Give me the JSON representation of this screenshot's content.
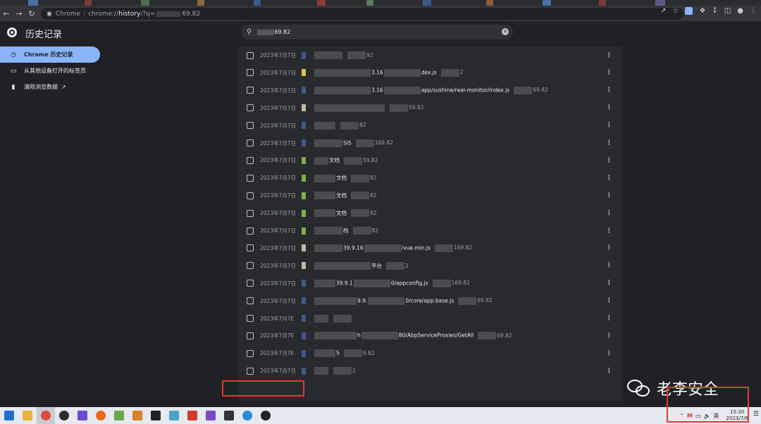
{
  "window": {
    "address": {
      "scheme_label": "Chrome",
      "url_prefix": "chrome://",
      "url_path": "history",
      "url_suffix": "/?q=",
      "url_tail": "69.82"
    }
  },
  "page": {
    "title": "历史记录",
    "search_value_tail": "69.82"
  },
  "sidebar": {
    "items": [
      {
        "label": "Chrome 历史记录",
        "icon": "clock-icon",
        "active": true
      },
      {
        "label": "从其他设备打开的标签页",
        "icon": "devices-icon",
        "active": false
      },
      {
        "label": "清除浏览数据",
        "icon": "trash-icon",
        "active": false
      }
    ]
  },
  "history": {
    "entries": [
      {
        "date": "2023年7月7日",
        "title": "",
        "domain": "92",
        "favicon_color": "#3c5a8a"
      },
      {
        "date": "2023年7月7日",
        "title": "3.16",
        "title2": "dex.js",
        "domain": "2",
        "favicon_color": "#d9c34a"
      },
      {
        "date": "2023年7月7日",
        "title": "3.16",
        "title2": "app/sushine/real-monitor/index.js",
        "domain": "69.82",
        "favicon_color": "#3c5a8a"
      },
      {
        "date": "2023年7月7日",
        "title": "",
        "domain": "59.82",
        "favicon_color": "#c2b8a0"
      },
      {
        "date": "2023年7月7日",
        "title": "",
        "domain": "82",
        "favicon_color": "#3c5a8a"
      },
      {
        "date": "2023年7月7日",
        "title": "SIS",
        "domain": "169.82",
        "favicon_color": "#3c5a8a"
      },
      {
        "date": "2023年7月7日",
        "title": "文档",
        "domain": "59.82",
        "favicon_color": "#7ab04a"
      },
      {
        "date": "2023年7月7日",
        "title": "文档",
        "domain": "82",
        "favicon_color": "#7ab04a"
      },
      {
        "date": "2023年7月7日",
        "title": "文档",
        "domain": "82",
        "favicon_color": "#7ab04a"
      },
      {
        "date": "2023年7月7日",
        "title": "文档",
        "domain": "82",
        "favicon_color": "#7ab04a"
      },
      {
        "date": "2023年7月7日",
        "title": "档",
        "domain": "82",
        "favicon_color": "#7ab04a"
      },
      {
        "date": "2023年7月7日",
        "title": "39.9.16",
        "title2": "/vue.min.js",
        "domain": "169.82",
        "favicon_color": "#c2b8a0"
      },
      {
        "date": "2023年7月7日",
        "title": "平台",
        "domain": "2",
        "favicon_color": "#c2b8a0"
      },
      {
        "date": "2023年7月7日",
        "title": "39.9.1",
        "title2": "0/appconfig.js",
        "domain": "169.82",
        "favicon_color": "#3c5a8a"
      },
      {
        "date": "2023年7月7日",
        "title": "9.9.",
        "title2": "0/core/app.base.js",
        "domain": "69.82",
        "favicon_color": "#3c5a8a"
      },
      {
        "date": "2023年7月7E",
        "title": "",
        "domain": "",
        "favicon_color": "#3c5a8a"
      },
      {
        "date": "2023年7月7E",
        "title": "h",
        "title2": "80/AbpServiceProxies/GetAll",
        "domain": "69.82",
        "favicon_color": "#3c5a8a"
      },
      {
        "date": "2023年7月7E",
        "title": "S",
        "domain": "9.82",
        "favicon_color": "#3c5a8a"
      },
      {
        "date": "2023年7月7日",
        "title": "",
        "domain": "2",
        "favicon_color": "#3c5a8a"
      }
    ]
  },
  "watermark": {
    "text": "老李安全"
  },
  "taskbar": {
    "ime": "英",
    "time": "15:20",
    "date": "2023/7/8"
  },
  "colors": {
    "accent": "#8ab4f8",
    "highlight_red": "#e53935"
  }
}
